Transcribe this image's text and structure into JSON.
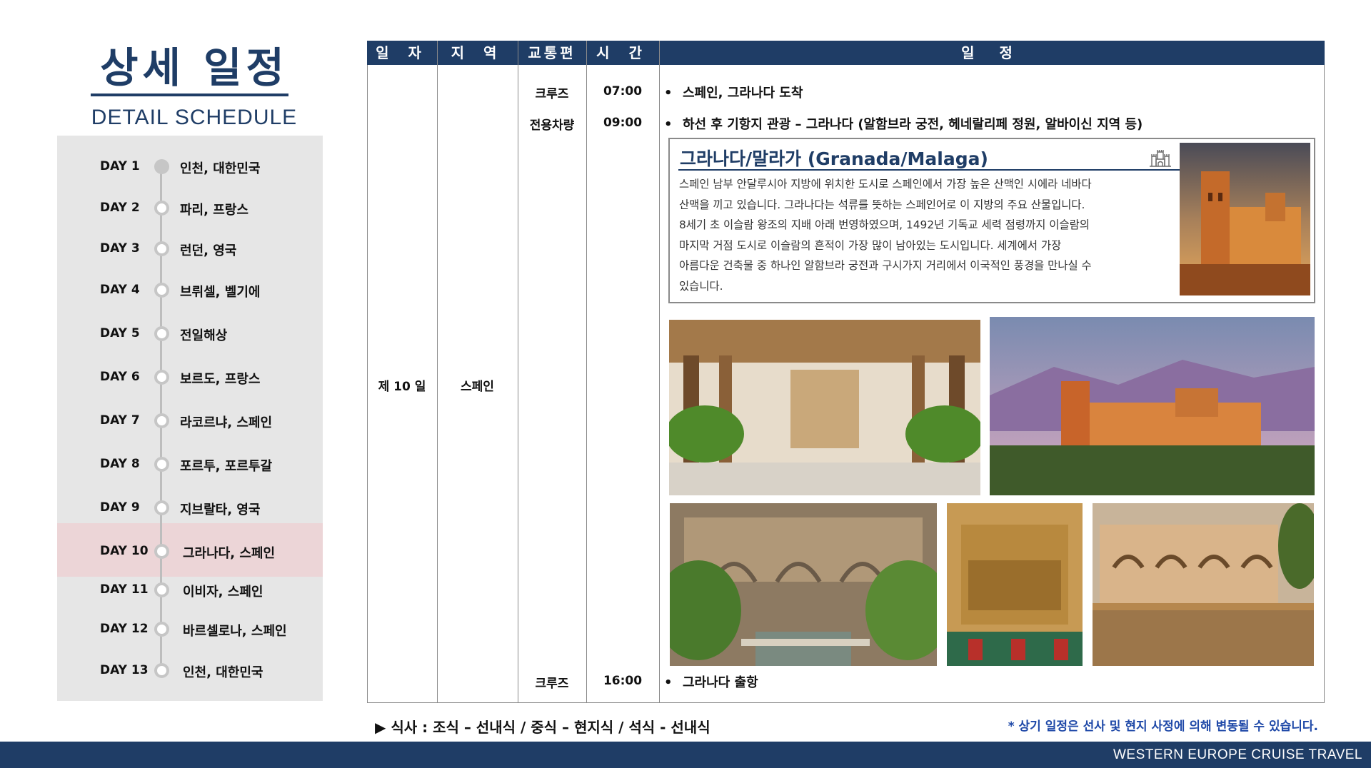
{
  "title": {
    "korean": "상세 일정",
    "english": "DETAIL SCHEDULE"
  },
  "days": [
    {
      "label": "DAY 1",
      "city": "인천, 대한민국"
    },
    {
      "label": "DAY 2",
      "city": "파리, 프랑스"
    },
    {
      "label": "DAY 3",
      "city": "런던, 영국"
    },
    {
      "label": "DAY 4",
      "city": "브뤼셀, 벨기에"
    },
    {
      "label": "DAY 5",
      "city": "전일해상"
    },
    {
      "label": "DAY 6",
      "city": "보르도, 프랑스"
    },
    {
      "label": "DAY 7",
      "city": "라코르냐, 스페인"
    },
    {
      "label": "DAY 8",
      "city": "포르투, 포르투갈"
    },
    {
      "label": "DAY 9",
      "city": "지브랄타, 영국"
    },
    {
      "label": "DAY 10",
      "city": "그라나다, 스페인"
    },
    {
      "label": "DAY 11",
      "city": "이비자, 스페인"
    },
    {
      "label": "DAY 12",
      "city": "바르셀로나, 스페인"
    },
    {
      "label": "DAY 13",
      "city": "인천, 대한민국"
    }
  ],
  "table": {
    "headers": {
      "day": "일 자",
      "region": "지 역",
      "transport": "교통편",
      "time": "시 간",
      "schedule": "일 정"
    },
    "day_value": "제 10 일",
    "region_value": "스페인",
    "rows": [
      {
        "transport": "크루즈",
        "time": "07:00",
        "text": "스페인, 그라나다 도착"
      },
      {
        "transport": "전용차량",
        "time": "09:00",
        "text": "하선 후 기항지 관광 – 그라나다 (알함브라 궁전, 헤네랄리페 정원, 알바이신 지역 등)"
      },
      {
        "transport": "크루즈",
        "time": "16:00",
        "text": "그라나다 출항"
      }
    ],
    "bullet": "•"
  },
  "info": {
    "title": "그라나다/말라가 (Granada/Malaga)",
    "lines": [
      "스페인 남부 안달루시아 지방에 위치한 도시로 스페인에서 가장 높은 산맥인 시에라 네바다",
      "산맥을 끼고 있습니다. 그라나다는 석류를 뜻하는 스페인어로 이 지방의 주요 산물입니다.",
      "8세기 초 이슬람 왕조의 지배 아래 번영하였으며, 1492년 기독교 세력 점령까지 이슬람의",
      "마지막 거점 도시로 이슬람의 흔적이 가장 많이 남아있는 도시입니다. 세계에서 가장",
      "아름다운 건축물 중 하나인 알함브라 궁전과 구시가지 거리에서 이국적인 풍경을 만나실 수",
      "있습니다."
    ]
  },
  "footer": {
    "meal": "▶ 식사 : 조식 – 선내식 / 중식 – 현지식 / 석식 - 선내식",
    "note": "* 상기 일정은 선사 및 현지 사정에 의해 변동될 수 있습니다.",
    "brand": "WESTERN EUROPE CRUISE TRAVEL"
  },
  "colors": {
    "navy": "#1f3d66",
    "panel": "#e6e6e6",
    "highlight": "#ecd5d7",
    "note_blue": "#1f49a8"
  },
  "highlighted_day": "DAY 10",
  "icons": [
    "castle-icon"
  ]
}
